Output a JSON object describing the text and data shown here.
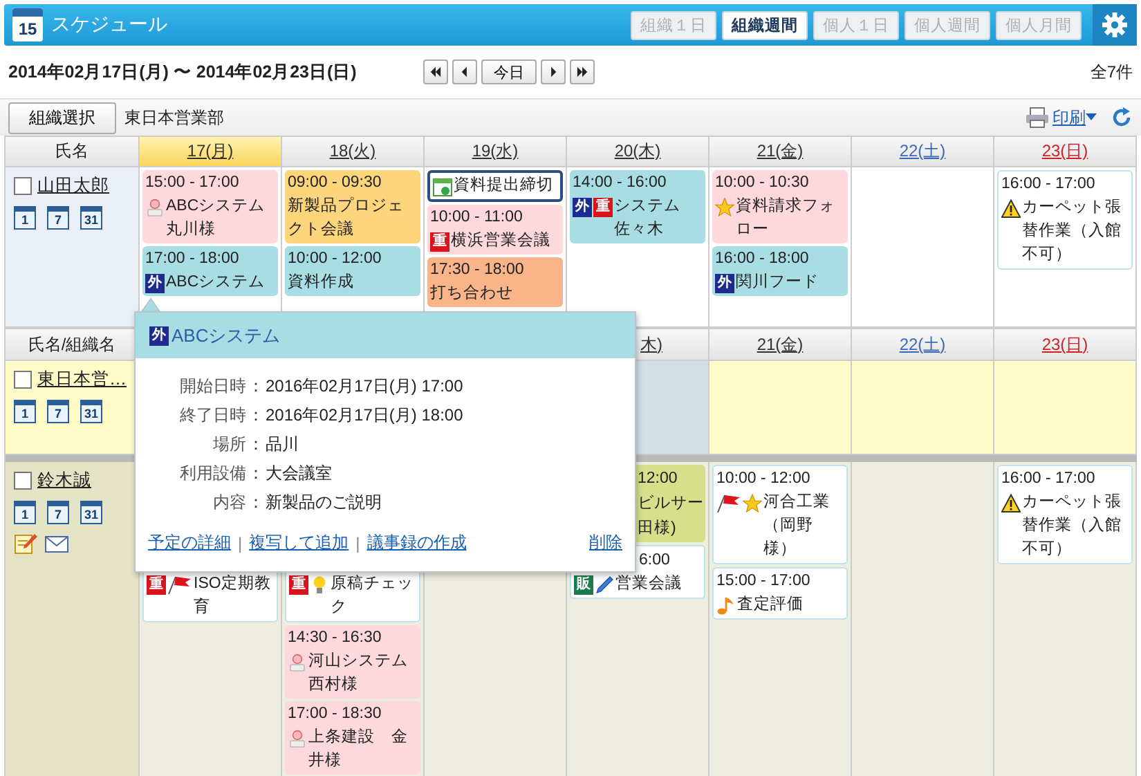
{
  "app": {
    "icon_day": "15",
    "title": "スケジュール"
  },
  "view_tabs": [
    {
      "label": "組織１日",
      "selected": false
    },
    {
      "label": "組織週間",
      "selected": true
    },
    {
      "label": "個人１日",
      "selected": false
    },
    {
      "label": "個人週間",
      "selected": false
    },
    {
      "label": "個人月間",
      "selected": false
    }
  ],
  "date_range": "2014年02月17日(月) 〜 2014年02月23日(日)",
  "nav": {
    "today": "今日"
  },
  "count": "全7件",
  "toolbar": {
    "select_button": "組織選択",
    "organization": "東日本営業部",
    "print": "印刷"
  },
  "table1": {
    "header": {
      "name_label": "氏名",
      "days": [
        {
          "label": "17(月)",
          "kind": "weekday",
          "selected": true
        },
        {
          "label": "18(火)",
          "kind": "weekday",
          "selected": false
        },
        {
          "label": "19(水)",
          "kind": "weekday",
          "selected": false
        },
        {
          "label": "20(木)",
          "kind": "weekday",
          "selected": false
        },
        {
          "label": "21(金)",
          "kind": "weekday",
          "selected": false
        },
        {
          "label": "22(土)",
          "kind": "saturday",
          "selected": false
        },
        {
          "label": "23(日)",
          "kind": "sunday",
          "selected": false
        }
      ]
    },
    "rows": [
      {
        "kind": "self",
        "name": "山田太郎",
        "checked": false,
        "views": [
          "1",
          "7",
          "31"
        ],
        "days": {
          "mon": [
            {
              "kind": "fill",
              "color": "#fdd8dc",
              "time": "15:00 - 17:00",
              "icons": [
                {
                  "kind": "visitor"
                }
              ],
              "title": "ABCシステム丸川様"
            },
            {
              "kind": "fill",
              "color": "#a9dde4",
              "time": "17:00 - 18:00",
              "icons": [
                {
                  "kind": "badge",
                  "text": "外",
                  "color": "#1d2b8e"
                }
              ],
              "title": "ABCシステム"
            }
          ],
          "tue": [
            {
              "kind": "fill",
              "color": "#fcd57c",
              "time": "09:00 - 09:30",
              "title": "新製品プロジェクト会議"
            },
            {
              "kind": "fill",
              "color": "#a9dde4",
              "time": "10:00 - 12:00",
              "title": "資料作成"
            }
          ],
          "wed": [
            {
              "kind": "focused",
              "color": "#ffffff",
              "icons": [
                {
                  "kind": "task"
                }
              ],
              "title": "資料提出締切"
            },
            {
              "kind": "fill",
              "color": "#fdd8dc",
              "time": "10:00 - 11:00",
              "icons": [
                {
                  "kind": "badge",
                  "text": "重",
                  "color": "#d8141c"
                }
              ],
              "title": "横浜営業会議"
            },
            {
              "kind": "fill",
              "color": "#f9b48a",
              "time": "17:30 - 18:00",
              "title": "打ち合わせ"
            }
          ],
          "thu": [
            {
              "kind": "fill",
              "color": "#a9dde4",
              "time": "14:00 - 16:00",
              "icons": [
                {
                  "kind": "badge",
                  "text": "外",
                  "color": "#1d2b8e"
                },
                {
                  "kind": "badge",
                  "text": "重",
                  "color": "#d8141c"
                }
              ],
              "title": "システム佐々木"
            }
          ],
          "fri": [
            {
              "kind": "fill",
              "color": "#fdd8dc",
              "time": "10:00 - 10:30",
              "icons": [
                {
                  "kind": "star"
                }
              ],
              "title": "資料請求フォロー"
            },
            {
              "kind": "fill",
              "color": "#a9dde4",
              "time": "16:00 - 18:00",
              "icons": [
                {
                  "kind": "badge",
                  "text": "外",
                  "color": "#1d2b8e"
                }
              ],
              "title": "関川フード"
            }
          ],
          "sun": [
            {
              "kind": "bordered",
              "color": "#ffffff",
              "time": "16:00 - 17:00",
              "icons": [
                {
                  "kind": "warning"
                }
              ],
              "title": "カーペット張替作業（入館不可）"
            }
          ]
        }
      }
    ]
  },
  "table2": {
    "header": {
      "name_label": "氏名/組織名",
      "days": [
        {
          "label": "木)",
          "kind": "weekday",
          "selected": false,
          "cut": true
        },
        {
          "label": "21(金)",
          "kind": "weekday",
          "selected": false
        },
        {
          "label": "22(土)",
          "kind": "saturday",
          "selected": false
        },
        {
          "label": "23(日)",
          "kind": "sunday",
          "selected": false
        }
      ]
    },
    "group_row": {
      "name": "東日本営…",
      "checked": false,
      "views": [
        "1",
        "7",
        "31"
      ],
      "cells": [
        {
          "color": "#d3dfe7"
        },
        {
          "color": "#fffcc9"
        },
        {
          "color": "#fffcc9"
        },
        {
          "color": "#fffcc9"
        }
      ]
    },
    "rows": [
      {
        "kind": "member",
        "name": "鈴木誠",
        "checked": false,
        "views": [
          "1",
          "7",
          "31"
        ],
        "actions": [
          {
            "kind": "memo"
          },
          {
            "kind": "mail"
          }
        ],
        "days": {
          "mon": [
            {
              "kind": "bordered",
              "color": "#ffffff",
              "covered": true,
              "icons": [
                {
                  "kind": "badge",
                  "text": "重",
                  "color": "#d8141c"
                },
                {
                  "kind": "flag"
                }
              ],
              "title": "ISO定期教育"
            }
          ],
          "tue": [
            {
              "kind": "bordered",
              "color": "#ffffff",
              "covered": true,
              "icons": [
                {
                  "kind": "badge",
                  "text": "重",
                  "color": "#d8141c"
                },
                {
                  "kind": "bulb"
                }
              ],
              "title": "原稿チェック"
            },
            {
              "kind": "fill",
              "color": "#fdd8dc",
              "time": "14:30 - 16:30",
              "icons": [
                {
                  "kind": "visitor"
                }
              ],
              "title": "河山システム西村様"
            },
            {
              "kind": "fill",
              "color": "#fdd8dc",
              "time": "17:00 - 18:30",
              "icons": [
                {
                  "kind": "visitor"
                }
              ],
              "title": "上条建設　金井様"
            }
          ],
          "thu": [
            {
              "kind": "fill",
              "color": "#d6e08b",
              "cut_lines": [
                "12:00",
                "ビルサー",
                "田様)"
              ]
            },
            {
              "kind": "bordered",
              "color": "#ffffff",
              "cut_lines": [
                "6:00"
              ],
              "icons": [
                {
                  "kind": "badge",
                  "text": "販",
                  "color": "#1d7a4c"
                },
                {
                  "kind": "pen"
                }
              ],
              "title": "営業会議"
            }
          ],
          "fri": [
            {
              "kind": "bordered",
              "color": "#ffffff",
              "time": "10:00 - 12:00",
              "icons": [
                {
                  "kind": "flag"
                },
                {
                  "kind": "star"
                }
              ],
              "title": "河合工業（岡野様）"
            },
            {
              "kind": "bordered",
              "color": "#ffffff",
              "time": "15:00 - 17:00",
              "icons": [
                {
                  "kind": "note"
                }
              ],
              "title": "査定評価"
            }
          ],
          "sun": [
            {
              "kind": "bordered",
              "color": "#ffffff",
              "time": "16:00 - 17:00",
              "icons": [
                {
                  "kind": "warning"
                }
              ],
              "title": "カーペット張替作業（入館不可）"
            }
          ]
        }
      }
    ]
  },
  "popup": {
    "badge": {
      "text": "外",
      "color": "#1d2b8e"
    },
    "title": "ABCシステム",
    "separator": "：",
    "fields": [
      {
        "label": "開始日時",
        "value": "2016年02月17日(月) 17:00"
      },
      {
        "label": "終了日時",
        "value": "2016年02月17日(月) 18:00"
      },
      {
        "label": "場所",
        "value": "品川"
      },
      {
        "label": "利用設備",
        "value": "大会議室"
      },
      {
        "label": "内容",
        "value": "新製品のご説明"
      }
    ],
    "links": [
      "予定の詳細",
      "複写して追加",
      "議事録の作成"
    ],
    "link_separator": "|",
    "delete": "削除"
  }
}
